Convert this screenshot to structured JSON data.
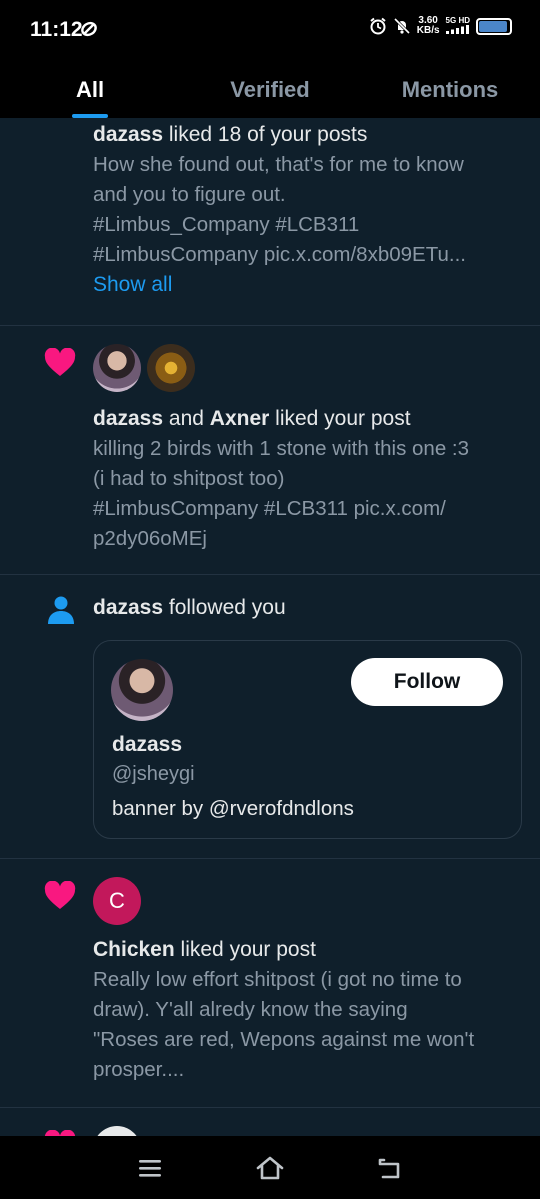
{
  "status_bar": {
    "time": "11:12",
    "speed_value": "3.60",
    "speed_unit": "KB/s",
    "network_top": "5G HD",
    "network_bottom": "",
    "battery_level": 0.95
  },
  "tabs": [
    {
      "label": "All",
      "active": true
    },
    {
      "label": "Verified",
      "active": false
    },
    {
      "label": "Mentions",
      "active": false
    }
  ],
  "notifications": {
    "n1": {
      "user": "dazass",
      "action": "liked 18 of your posts",
      "lines": [
        "How she found out, that's for me to know",
        "and you to figure out.",
        "#Limbus_Company #LCB311",
        "#LimbusCompany pic.x.com/8xb09ETu..."
      ],
      "show_all": "Show all"
    },
    "n2": {
      "user1": "dazass",
      "joiner": "and",
      "user2": "Axner",
      "action": "liked your post",
      "lines": [
        "killing 2 birds with 1 stone with this one :3",
        "(i had to shitpost too)",
        "#LimbusCompany #LCB311 pic.x.com/",
        "p2dy06oMEj"
      ]
    },
    "n3": {
      "user": "dazass",
      "action": "followed you",
      "card": {
        "name": "dazass",
        "handle": "@jsheygi",
        "bio": "banner by @rverofdndlons",
        "follow_label": "Follow"
      }
    },
    "n4": {
      "avatar_letter": "C",
      "user": "Chicken",
      "action": "liked your post",
      "lines": [
        "Really low effort shitpost (i got no time to",
        "draw). Y'all alredy know the saying",
        "\"Roses are red, Wepons against me won't",
        "prosper...."
      ]
    }
  },
  "colors": {
    "accent": "#1d9bf0",
    "heart": "#f91880",
    "background": "#0f1f2b"
  }
}
